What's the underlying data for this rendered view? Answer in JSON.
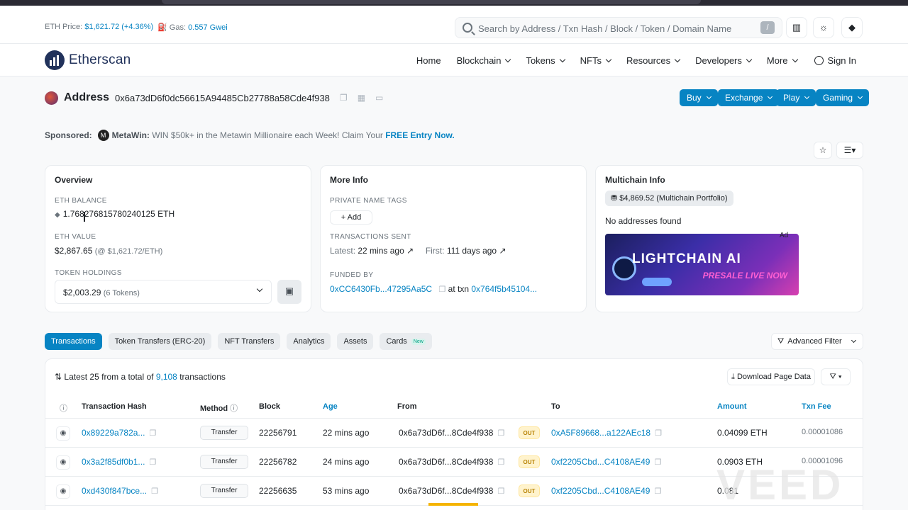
{
  "topbar": {
    "eth_price_label": "ETH Price:",
    "eth_price_value": "$1,621.72 (+4.36%)",
    "gas_label": "Gas:",
    "gas_value": "0.557 Gwei",
    "search_placeholder": "Search by Address / Txn Hash / Block / Token / Domain Name",
    "search_shortcut": "/"
  },
  "nav": {
    "logo_text": "Etherscan",
    "items": [
      "Home",
      "Blockchain",
      "Tokens",
      "NFTs",
      "Resources",
      "Developers",
      "More"
    ],
    "signin": "Sign In"
  },
  "address": {
    "label": "Address",
    "hash": "0x6a73dD6f0dc56615A94485Cb27788a58Cde4f938",
    "buttons": [
      "Buy",
      "Exchange",
      "Play",
      "Gaming"
    ]
  },
  "sponsored": {
    "label": "Sponsored:",
    "brand": "MetaWin:",
    "text": "WIN $50k+ in the Metawin Millionaire each Week! Claim Your",
    "cta": "FREE Entry Now."
  },
  "overview": {
    "title": "Overview",
    "eth_balance_label": "ETH BALANCE",
    "eth_balance": "1.768276815780240125 ETH",
    "eth_value_label": "ETH VALUE",
    "eth_value": "$2,867.65",
    "eth_value_rate": "(@ $1,621.72/ETH)",
    "token_holdings_label": "TOKEN HOLDINGS",
    "token_holdings": "$2,003.29",
    "token_count": "(6 Tokens)"
  },
  "more_info": {
    "title": "More Info",
    "private_tags_label": "PRIVATE NAME TAGS",
    "add_label": "+ Add",
    "tx_sent_label": "TRANSACTIONS SENT",
    "latest_label": "Latest:",
    "latest_value": "22 mins ago ↗",
    "first_label": "First:",
    "first_value": "111 days ago ↗",
    "funded_by_label": "FUNDED BY",
    "funded_by": "0xCC6430Fb...47295Aa5C",
    "at_txn": "at txn",
    "funded_txn": "0x764f5b45104..."
  },
  "multichain": {
    "title": "Multichain Info",
    "portfolio": "$4,869.52 (Multichain Portfolio)",
    "no_addresses": "No addresses found",
    "ad_label": "Ad",
    "banner_text": "LIGHTCHAIN AI",
    "banner_sub": "PRESALE LIVE NOW"
  },
  "tabs": [
    {
      "label": "Transactions"
    },
    {
      "label": "Token Transfers (ERC-20)"
    },
    {
      "label": "NFT Transfers"
    },
    {
      "label": "Analytics"
    },
    {
      "label": "Assets"
    },
    {
      "label": "Cards",
      "badge": "New"
    }
  ],
  "advanced_filter": "Advanced Filter",
  "tx": {
    "summary_prefix": "Latest 25 from a total of",
    "total": "9,108",
    "summary_suffix": "transactions",
    "download": "Download Page Data",
    "headers": [
      "Transaction Hash",
      "Method",
      "Block",
      "Age",
      "From",
      "To",
      "Amount",
      "Txn Fee"
    ],
    "rows": [
      {
        "hash": "0x89229a782a...",
        "method": "Transfer",
        "block": "22256791",
        "age": "22 mins ago",
        "from": "0x6a73dD6f...8Cde4f938",
        "dir": "OUT",
        "to": "0xA5F89668...a122AEc18",
        "amount": "0.04099 ETH",
        "fee": "0.00001086"
      },
      {
        "hash": "0x3a2f85df0b1...",
        "method": "Transfer",
        "block": "22256782",
        "age": "24 mins ago",
        "from": "0x6a73dD6f...8Cde4f938",
        "dir": "OUT",
        "to": "0xf2205Cbd...C4108AE49",
        "amount": "0.0903 ETH",
        "fee": "0.00001096"
      },
      {
        "hash": "0xd430f847bce...",
        "method": "Transfer",
        "block": "22256635",
        "age": "53 mins ago",
        "from": "0x6a73dD6f...8Cde4f938",
        "dir": "OUT",
        "to": "0xf2205Cbd...C4108AE49",
        "amount": "0.081",
        "fee": ""
      }
    ]
  },
  "watermark": "VEED",
  "colors": {
    "accent": "#0784c3",
    "navy": "#21325b",
    "out_badge": "#fff3cd"
  }
}
